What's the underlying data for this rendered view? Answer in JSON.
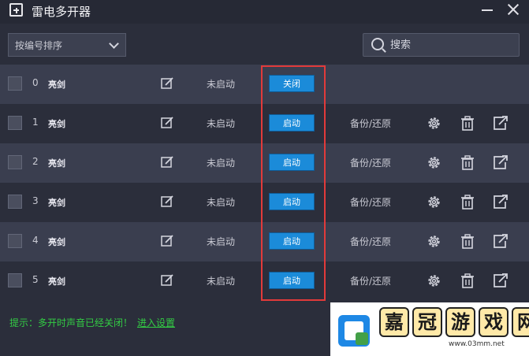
{
  "window": {
    "title": "雷电多开器"
  },
  "toolbar": {
    "sort_label": "按编号排序",
    "search_placeholder": "搜索"
  },
  "rows": [
    {
      "index": "0",
      "name": "亮剑",
      "status": "未启动",
      "action": "关闭",
      "backup": ""
    },
    {
      "index": "1",
      "name": "亮剑",
      "status": "未启动",
      "action": "启动",
      "backup": "备份/还原"
    },
    {
      "index": "2",
      "name": "亮剑",
      "status": "未启动",
      "action": "启动",
      "backup": "备份/还原"
    },
    {
      "index": "3",
      "name": "亮剑",
      "status": "未启动",
      "action": "启动",
      "backup": "备份/还原"
    },
    {
      "index": "4",
      "name": "亮剑",
      "status": "未启动",
      "action": "启动",
      "backup": "备份/还原"
    },
    {
      "index": "5",
      "name": "亮剑",
      "status": "未启动",
      "action": "启动",
      "backup": "备份/还原"
    }
  ],
  "footer": {
    "tip": "提示：多开时声音已经关闭！",
    "link": "进入设置"
  },
  "watermark": {
    "chars": [
      "嘉",
      "冠",
      "游",
      "戏",
      "网"
    ],
    "url": "www.03mm.net"
  },
  "colors": {
    "accent_button": "#1b8bd9",
    "highlight_border": "#e23a3a",
    "tip_green": "#33cc44"
  }
}
